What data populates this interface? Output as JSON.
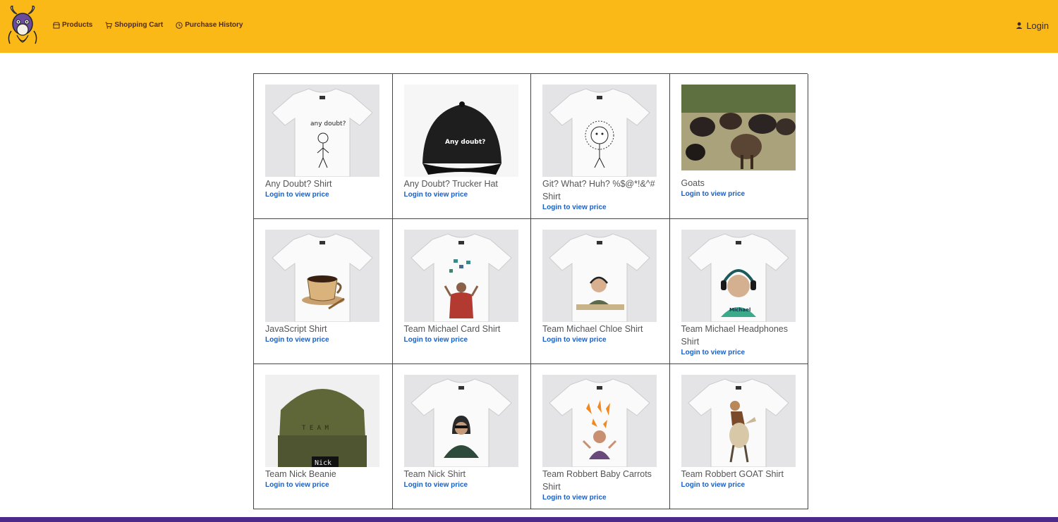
{
  "header": {
    "brand_color": "#fbb917",
    "nav": [
      {
        "label": "Products",
        "icon": "store-icon"
      },
      {
        "label": "Shopping Cart",
        "icon": "cart-icon"
      },
      {
        "label": "Purchase History",
        "icon": "clock-icon"
      }
    ],
    "login_label": "Login"
  },
  "products": [
    {
      "name": "Any Doubt? Shirt",
      "price_label": "Login to view price",
      "image": "tshirt-stickfigure-any-doubt"
    },
    {
      "name": "Any Doubt? Trucker Hat",
      "price_label": "Login to view price",
      "image": "black-trucker-hat"
    },
    {
      "name": "Git? What? Huh? %$@*!&^# Shirt",
      "price_label": "Login to view price",
      "image": "tshirt-confused-figure"
    },
    {
      "name": "Goats",
      "price_label": "Login to view price",
      "image": "goats-photo"
    },
    {
      "name": "JavaScript Shirt",
      "price_label": "Login to view price",
      "image": "tshirt-coffee-cup"
    },
    {
      "name": "Team Michael Card Shirt",
      "price_label": "Login to view price",
      "image": "tshirt-card-man"
    },
    {
      "name": "Team Michael Chloe Shirt",
      "price_label": "Login to view price",
      "image": "tshirt-headphones-desk-man"
    },
    {
      "name": "Team Michael Headphones Shirt",
      "price_label": "Login to view price",
      "image": "tshirt-headphones-man"
    },
    {
      "name": "Team Nick Beanie",
      "price_label": "Login to view price",
      "image": "olive-beanie"
    },
    {
      "name": "Team Nick Shirt",
      "price_label": "Login to view price",
      "image": "tshirt-hoodie-man"
    },
    {
      "name": "Team Robbert Baby Carrots Shirt",
      "price_label": "Login to view price",
      "image": "tshirt-carrots-man"
    },
    {
      "name": "Team Robbert GOAT Shirt",
      "price_label": "Login to view price",
      "image": "tshirt-goat-rider"
    }
  ]
}
